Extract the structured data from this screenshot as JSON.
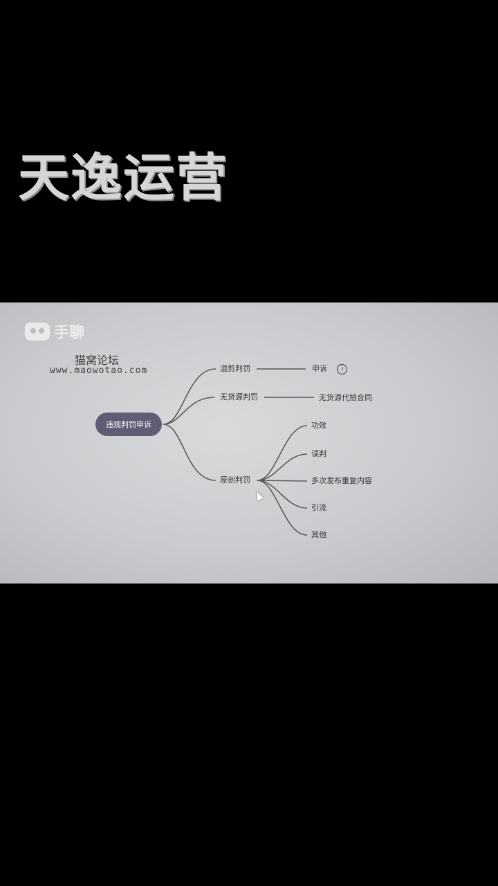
{
  "overlay": {
    "title": "天逸运营"
  },
  "watermark": {
    "icon": "cat-face-icon",
    "text": "手聊"
  },
  "forum": {
    "name": "猫窝论坛",
    "url": "www.maowotao.com"
  },
  "mindmap": {
    "root": "违规判罚申诉",
    "branches": [
      {
        "label": "混剪判罚",
        "children": [
          "申诉"
        ]
      },
      {
        "label": "无货源判罚",
        "children": [
          "无货源代拍合同"
        ]
      },
      {
        "label": "原创判罚",
        "children": [
          "功效",
          "误判",
          "多次发布重复内容",
          "引流",
          "其他"
        ]
      }
    ],
    "info_icon_text": "i"
  },
  "colors": {
    "background": "#000000",
    "screen": "#cfd1d4",
    "root_fill": "#615c74",
    "overlay_text": "#d6d6d6"
  }
}
